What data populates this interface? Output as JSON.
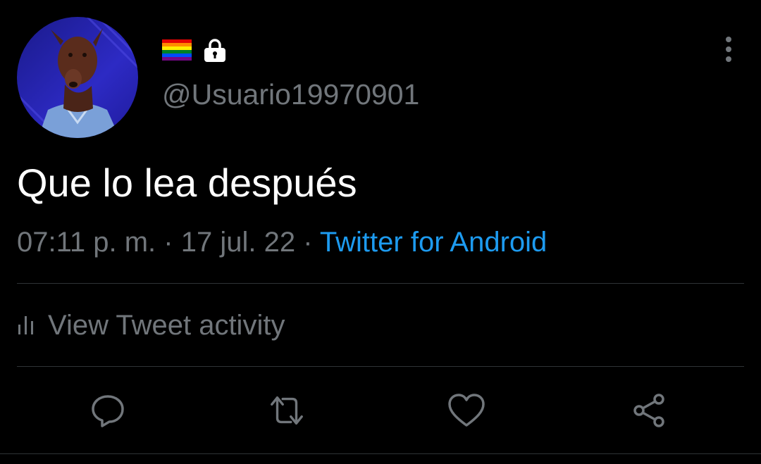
{
  "tweet": {
    "author": {
      "display_name_icons": [
        "rainbow-flag-icon",
        "lock-icon"
      ],
      "handle": "@Usuario19970901"
    },
    "text": "Que lo lea después",
    "meta": {
      "time": "07:11 p. m.",
      "separator": "·",
      "date": "17 jul. 22",
      "source": "Twitter for Android"
    },
    "activity": {
      "label": "View Tweet activity",
      "icon": "bar-chart-icon"
    },
    "actions": [
      {
        "icon": "reply-icon"
      },
      {
        "icon": "retweet-icon"
      },
      {
        "icon": "like-icon"
      },
      {
        "icon": "share-icon"
      }
    ]
  },
  "colors": {
    "background": "#000000",
    "primary_text": "#ffffff",
    "secondary_text": "#71767b",
    "link": "#1d9bf0",
    "divider": "#2f3336",
    "avatar_bg": "#2a25b8"
  }
}
